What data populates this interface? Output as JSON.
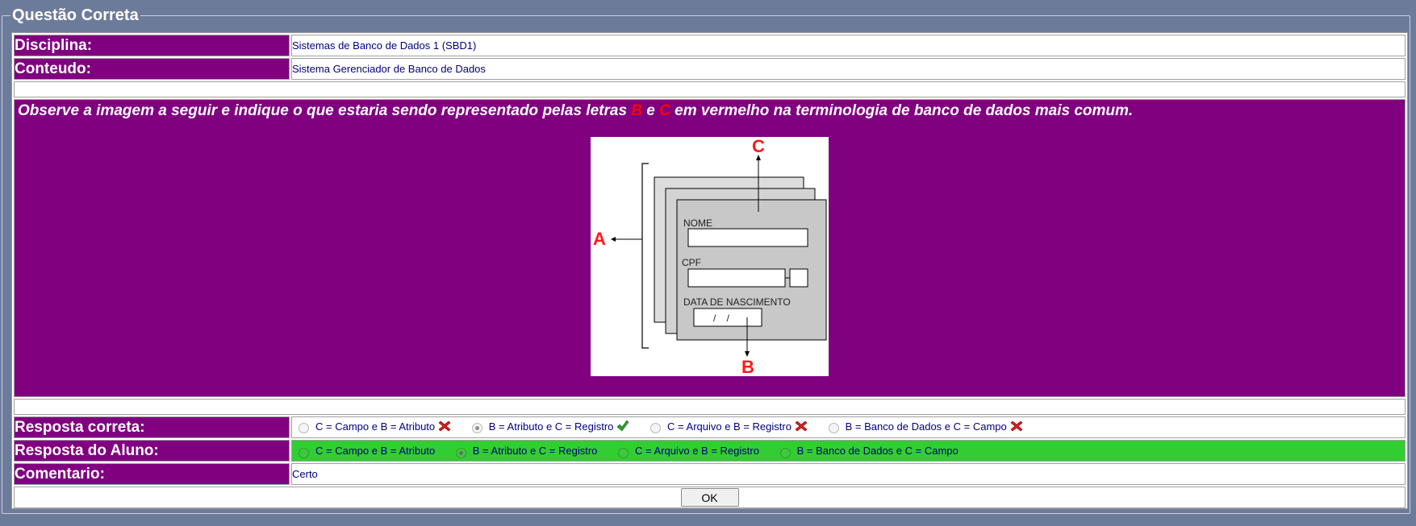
{
  "title": "Questão Correta",
  "disciplina": {
    "label": "Disciplina:",
    "value": "Sistemas de Banco de Dados 1 (SBD1)"
  },
  "conteudo": {
    "label": "Conteudo:",
    "value": "Sistema Gerenciador de Banco de Dados"
  },
  "question": {
    "part1": "Observe a imagem a seguir e indique o que estaria sendo representado pelas letras ",
    "letter_b": "B",
    "mid": " e ",
    "letter_c": "C",
    "part2": " em vermelho na terminologia de banco de dados mais comum."
  },
  "figure": {
    "label_a": "A",
    "label_b": "B",
    "label_c": "C",
    "field_nome": "NOME",
    "field_cpf": "CPF",
    "field_data": "DATA DE NASCIMENTO",
    "date_placeholder": "/    /"
  },
  "resposta_correta": {
    "label": "Resposta correta:",
    "options": [
      {
        "text": "C = Campo e B = Atributo",
        "selected": false,
        "mark": "x-icon"
      },
      {
        "text": "B = Atributo e C = Registro",
        "selected": true,
        "mark": "check-icon"
      },
      {
        "text": "C = Arquivo e B = Registro",
        "selected": false,
        "mark": "x-icon"
      },
      {
        "text": "B = Banco de Dados e C = Campo",
        "selected": false,
        "mark": "x-icon"
      }
    ]
  },
  "resposta_aluno": {
    "label": "Resposta do Aluno:",
    "options": [
      {
        "text": "C = Campo e B = Atributo",
        "selected": false
      },
      {
        "text": "B = Atributo e C = Registro",
        "selected": true
      },
      {
        "text": "C = Arquivo e B = Registro",
        "selected": false
      },
      {
        "text": "B = Banco de Dados e C = Campo",
        "selected": false
      }
    ]
  },
  "comentario": {
    "label": "Comentario:",
    "value": "Certo"
  },
  "ok_button": "OK",
  "colors": {
    "background": "#6d7b9b",
    "label_bg": "#800080",
    "correct_bg": "#32cd32",
    "red": "#ff0000"
  }
}
